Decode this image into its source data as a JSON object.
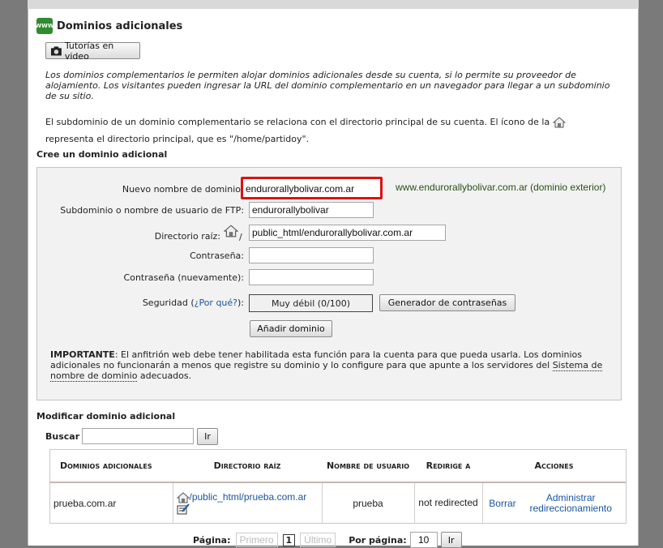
{
  "title": "Dominios adicionales",
  "video_button": "Tutorías en video",
  "intro": "Los dominios complementarios le permiten alojar dominios adicionales desde su cuenta, si lo permite su proveedor de alojamiento. Los visitantes pueden ingresar la URL del dominio complementario en un navegador para llegar a un subdominio de su sitio.",
  "subdomain_text_1": "El subdominio de un dominio complementario se relaciona con el directorio principal de su cuenta. El ícono de la",
  "subdomain_text_2": "representa el directorio principal, que es \"/home/partidoy\".",
  "create_title": "Cree un dominio adicional",
  "form": {
    "domain_label": "Nuevo nombre de dominio",
    "domain_value": "endurorallybolivar.com.ar",
    "domain_hint": "www.endurorallybolivar.com.ar (dominio exterior)",
    "ftp_label": "Subdominio o nombre de usuario de FTP:",
    "ftp_value": "endurorallybolivar",
    "root_label": "Directorio raíz:",
    "root_slash": "/",
    "root_value": "public_html/endurorallybolivar.com.ar",
    "password_label": "Contraseña:",
    "password_value": "",
    "password2_label": "Contraseña (nuevamente):",
    "password2_value": "",
    "security_label_pre": "Seguridad (",
    "security_link": "¿Por qué?",
    "security_label_post": "):",
    "strength": "Muy débil (0/100)",
    "generator_button": "Generador de contraseñas",
    "add_button": "Añadir dominio"
  },
  "important": {
    "label": "IMPORTANTE",
    "text": ": El anfitrión web debe tener habilitada esta función para la cuenta para que pueda usarla. Los dominios adicionales no funcionarán a menos que registre su dominio y lo configure para que apunte a los servidores del ",
    "link": "Sistema de nombre de dominio",
    "text_end": " adecuados."
  },
  "modify_title": "Modificar dominio adicional",
  "search": {
    "label": "Buscar",
    "value": "",
    "button": "Ir"
  },
  "table": {
    "headers": [
      "Dominios adicionales",
      "Directorio raíz",
      "Nombre de usuario",
      "Redirige a",
      "Acciones"
    ],
    "rows": [
      {
        "domain": "prueba.com.ar",
        "root": "/public_html/prueba.com.ar",
        "user": "prueba",
        "redirect": "not redirected",
        "delete": "Borrar",
        "manage": "Administrar redireccionamiento"
      }
    ]
  },
  "pager": {
    "page_label": "Página:",
    "first": "Primero",
    "current": "1",
    "last": "Último",
    "per_page_label": "Por página:",
    "per_page": "10",
    "go": "Ir"
  }
}
